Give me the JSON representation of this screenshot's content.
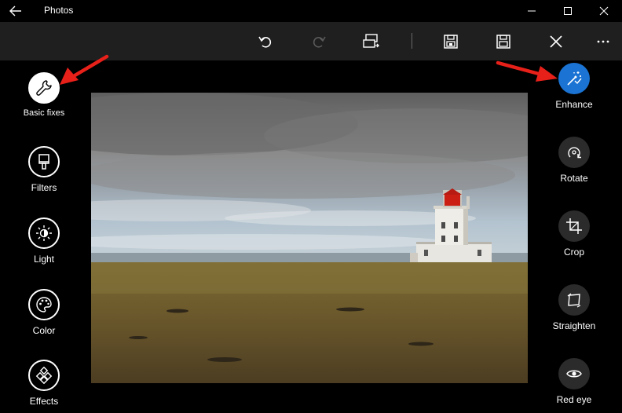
{
  "app": {
    "title": "Photos"
  },
  "left_tools": [
    {
      "label": "Basic fixes",
      "icon": "wrench-icon",
      "selected": true
    },
    {
      "label": "Filters",
      "icon": "brush-icon"
    },
    {
      "label": "Light",
      "icon": "sun-icon"
    },
    {
      "label": "Color",
      "icon": "palette-icon"
    },
    {
      "label": "Effects",
      "icon": "effects-icon"
    }
  ],
  "right_tools": [
    {
      "label": "Enhance",
      "icon": "magic-wand-icon",
      "selected": true
    },
    {
      "label": "Rotate",
      "icon": "rotate-icon"
    },
    {
      "label": "Crop",
      "icon": "crop-icon"
    },
    {
      "label": "Straighten",
      "icon": "straighten-icon"
    },
    {
      "label": "Red eye",
      "icon": "eye-icon"
    }
  ],
  "colors": {
    "accent": "#1b74d4",
    "annotation_arrow": "#e8201a",
    "toolbar": "#1f1f1f"
  }
}
